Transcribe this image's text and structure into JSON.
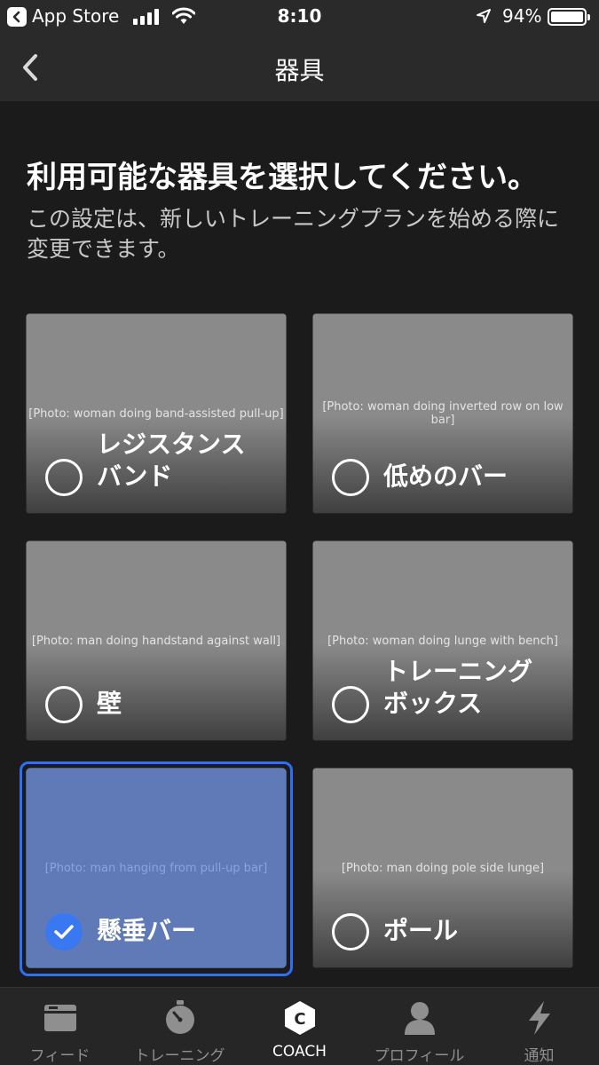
{
  "status": {
    "app": "App Store",
    "time": "8:10",
    "battery": "94%"
  },
  "nav": {
    "title": "器具"
  },
  "heading": "利用可能な器具を選択してください。",
  "subtext": "この設定は、新しいトレーニングプランを始める際に変更できます。",
  "cards": [
    {
      "lines": [
        "レジスタンス",
        "バンド"
      ],
      "selected": false
    },
    {
      "lines": [
        "低めのバー"
      ],
      "selected": false
    },
    {
      "lines": [
        "壁"
      ],
      "selected": false
    },
    {
      "lines": [
        "トレーニング",
        "ボックス"
      ],
      "selected": false
    },
    {
      "lines": [
        "懸垂バー"
      ],
      "selected": true
    },
    {
      "lines": [
        "ポール"
      ],
      "selected": false
    }
  ],
  "tabs": [
    {
      "label": "フィード",
      "icon": "feed-icon"
    },
    {
      "label": "トレーニング",
      "icon": "stopwatch-icon"
    },
    {
      "label": "COACH",
      "icon": "coach-icon",
      "active": true
    },
    {
      "label": "プロフィール",
      "icon": "profile-icon"
    },
    {
      "label": "通知",
      "icon": "lightning-icon"
    }
  ],
  "colors": {
    "background": "#1b1b1b",
    "bars": "#2a2a2a",
    "accent": "#2f6ff5",
    "check": "#3a78f2"
  }
}
